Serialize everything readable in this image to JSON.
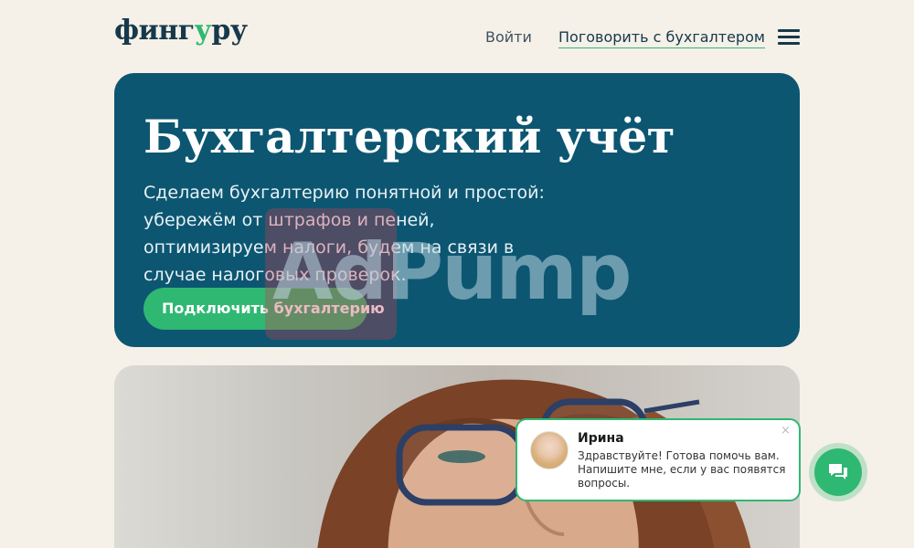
{
  "header": {
    "logo_prefix": "финг",
    "logo_accent": "у",
    "logo_suffix": "ру",
    "login_label": "Войти",
    "talk_label": "Поговорить с бухгалтером",
    "menu_icon": "burger-menu-icon"
  },
  "hero": {
    "title": "Бухгалтерский учёт",
    "subtitle": "Сделаем бухгалтерию понятной и простой: убережём от штрафов и пеней, оптимизируем налоги, будем на связи в случае налоговых проверок.",
    "cta_label": "Подключить бухгалтерию",
    "watermark": "AdPump"
  },
  "chat": {
    "agent_name": "Ирина",
    "message": "Здравствуйте! Готова помочь вам. Напишите мне, если у вас появятся вопросы.",
    "close_glyph": "×",
    "button_icon": "chat-icon"
  },
  "colors": {
    "background": "#f5f0e8",
    "hero": "#0c5672",
    "accent": "#2fb872",
    "text_dark": "#15394a"
  }
}
